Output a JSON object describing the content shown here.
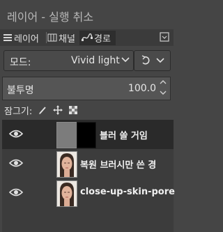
{
  "window": {
    "title": "레이어 - 실행 취소"
  },
  "tabs": [
    {
      "label": "레이어",
      "icon": "layers-icon"
    },
    {
      "label": "채널",
      "icon": "channels-icon"
    },
    {
      "label": "경로",
      "icon": "paths-icon"
    }
  ],
  "mode": {
    "label": "모드:",
    "value": "Vivid light"
  },
  "opacity": {
    "label": "불투명",
    "value": "100.0"
  },
  "lock": {
    "label": "잠그기:"
  },
  "layers": [
    {
      "name": "블러 쓸 거임",
      "selected": true,
      "visible": true
    },
    {
      "name": "복원 브러시만 쓴 경",
      "selected": false,
      "visible": true
    },
    {
      "name": "close-up-skin-pore",
      "selected": false,
      "visible": true
    }
  ]
}
